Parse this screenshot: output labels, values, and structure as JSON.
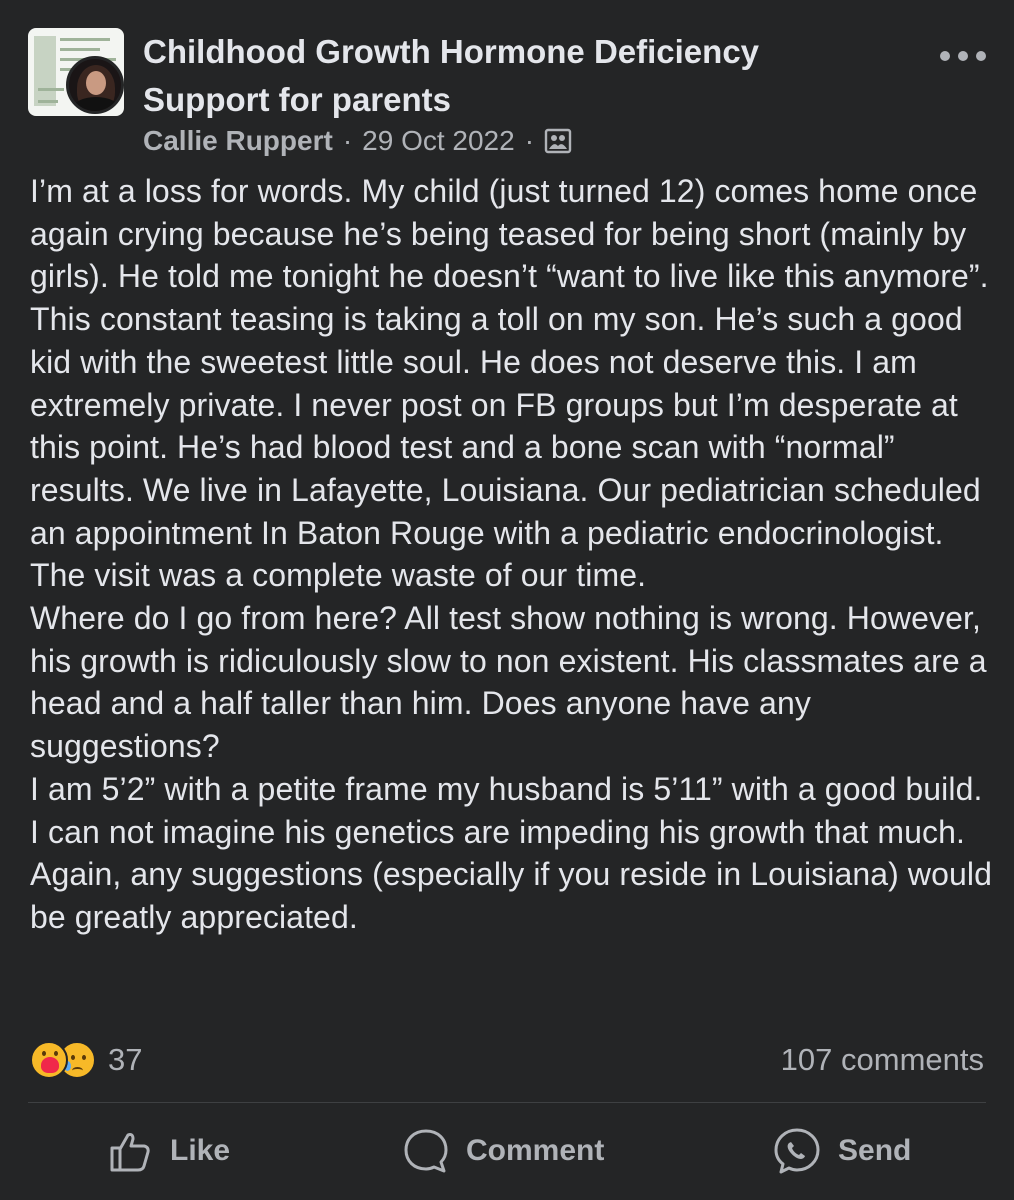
{
  "group": {
    "name": "Childhood Growth Hormone Deficiency Support for parents"
  },
  "post": {
    "author": "Callie Ruppert",
    "date": "29 Oct 2022",
    "separator": "·",
    "privacy_icon": "group-members-icon",
    "body": "I’m at a loss for words. My child (just turned 12) comes home once again crying because he’s being teased for being short (mainly by girls). He told me tonight he doesn’t “want to live like this anymore”. This constant teasing is taking a toll on my son. He’s such a good kid with the sweetest little soul. He does not deserve this. I am extremely private. I never post on FB groups but I’m desperate at this point. He’s had blood test and a bone scan with “normal” results. We live in Lafayette, Louisiana. Our pediatrician scheduled an appointment In Baton Rouge with a pediatric endocrinologist. The visit was a complete waste of our time.\nWhere do I go from here? All test show nothing is wrong. However, his growth is ridiculously slow to non existent. His classmates are a head and a half taller than him. Does anyone have any suggestions?\nI am 5’2” with a petite frame my husband is 5’11” with a good build. I can not imagine his genetics are impeding his growth that much. Again, any suggestions (especially if you reside in Louisiana) would be greatly appreciated."
  },
  "stats": {
    "reaction_icons": [
      "care-emoji-icon",
      "sad-emoji-icon"
    ],
    "reaction_count": "37",
    "comment_count": "107 comments"
  },
  "actions": {
    "like_label": "Like",
    "comment_label": "Comment",
    "send_label": "Send"
  },
  "colors": {
    "background": "#242526",
    "primary_text": "#e4e6eb",
    "secondary_text": "#b0b3b8",
    "divider": "#3e4042"
  }
}
